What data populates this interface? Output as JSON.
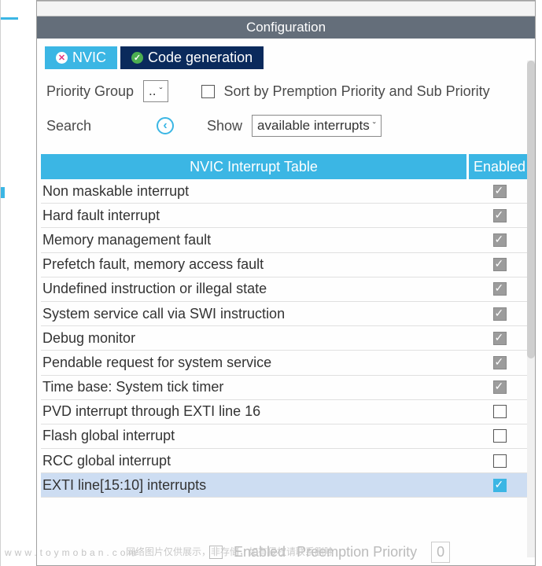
{
  "titlebar": "Configuration",
  "tabs": {
    "nvic": "NVIC",
    "codegen": "Code generation"
  },
  "priority_group_label": "Priority Group",
  "priority_group_value": "..",
  "sort_checkbox_label": "Sort by Premption Priority and Sub Priority",
  "search_label": "Search",
  "show_label": "Show",
  "show_value": "available interrupts",
  "table_headers": {
    "name": "NVIC Interrupt Table",
    "enabled": "Enabled"
  },
  "rows": [
    {
      "name": "Non maskable interrupt",
      "enabled": true,
      "locked": true
    },
    {
      "name": "Hard fault interrupt",
      "enabled": true,
      "locked": true
    },
    {
      "name": "Memory management fault",
      "enabled": true,
      "locked": true
    },
    {
      "name": "Prefetch fault, memory access fault",
      "enabled": true,
      "locked": true
    },
    {
      "name": "Undefined instruction or illegal state",
      "enabled": true,
      "locked": true
    },
    {
      "name": "System service call via SWI instruction",
      "enabled": true,
      "locked": true
    },
    {
      "name": "Debug monitor",
      "enabled": true,
      "locked": true
    },
    {
      "name": "Pendable request for system service",
      "enabled": true,
      "locked": true
    },
    {
      "name": "Time base: System tick timer",
      "enabled": true,
      "locked": true
    },
    {
      "name": "PVD interrupt through EXTI line 16",
      "enabled": false,
      "locked": false
    },
    {
      "name": "Flash global interrupt",
      "enabled": false,
      "locked": false
    },
    {
      "name": "RCC global interrupt",
      "enabled": false,
      "locked": false
    },
    {
      "name": "EXTI line[15:10] interrupts",
      "enabled": true,
      "locked": false,
      "selected": true
    }
  ],
  "footer": {
    "enabled_label": "Enabled",
    "preemption_label": "Preemption Priority",
    "preemption_value": "0"
  },
  "watermark_host": "www.toymoban.com",
  "watermark_text": "网络图片仅供展示，非存储，如有侵权请联系删除"
}
